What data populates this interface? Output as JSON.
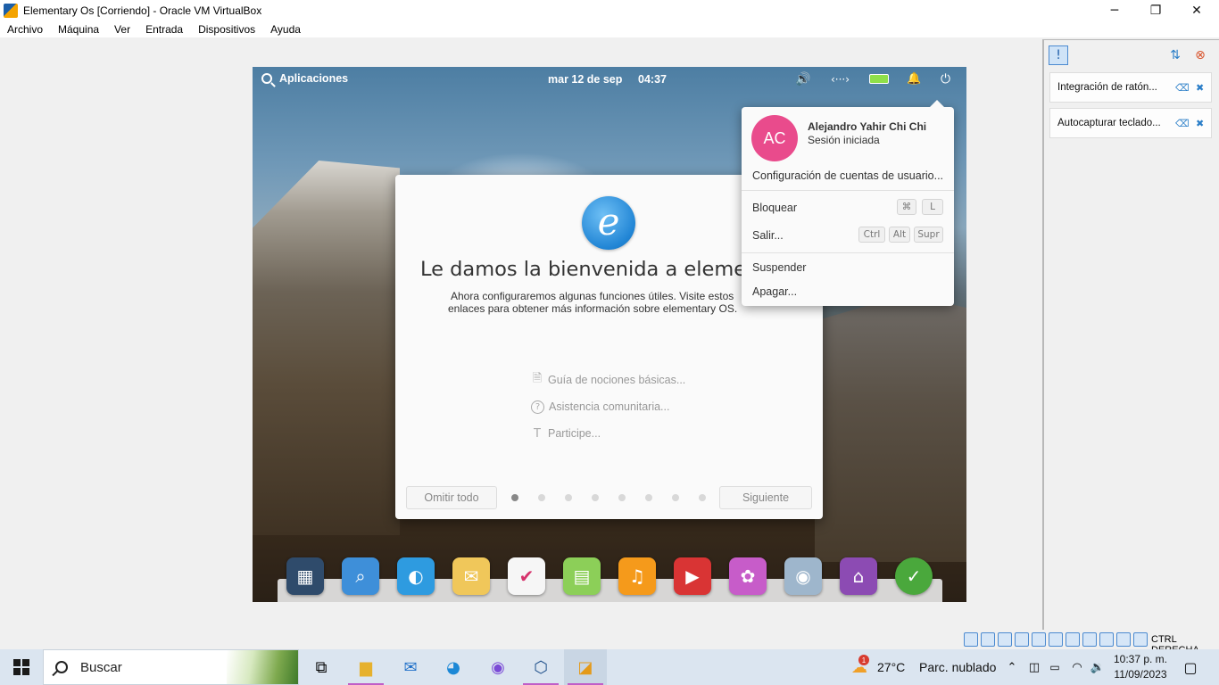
{
  "window": {
    "title": "Elementary Os [Corriendo] - Oracle VM VirtualBox",
    "controls": {
      "minimize": "─",
      "maximize": "❐",
      "close": "✕"
    }
  },
  "menubar": [
    "Archivo",
    "Máquina",
    "Ver",
    "Entrada",
    "Dispositivos",
    "Ayuda"
  ],
  "vm": {
    "panel": {
      "applications": "Aplicaciones",
      "date": "mar 12 de sep",
      "time": "04:37",
      "indicators": {
        "sound": "🔊",
        "network": "‹···›",
        "battery": "▬",
        "notifications": "🔔",
        "power": "⏻"
      }
    },
    "welcome": {
      "heading": "Le damos la bienvenida a elementary",
      "description_line1": "Ahora configuraremos algunas funciones útiles. Visite estos",
      "description_line2": "enlaces para obtener más información sobre elementary OS.",
      "links": [
        {
          "label": "Guía de nociones básicas...",
          "icon": "document-icon",
          "glyph": "🗎"
        },
        {
          "label": "Asistencia comunitaria...",
          "icon": "help-icon",
          "glyph": "?"
        },
        {
          "label": "Participe...",
          "icon": "hammer-icon",
          "glyph": "T"
        }
      ],
      "skip_label": "Omitir todo",
      "next_label": "Siguiente",
      "pages_total": 8,
      "current_page": 1
    },
    "session_menu": {
      "avatar_initials": "AC",
      "avatar_color": "#e94b8c",
      "user_name": "Alejandro Yahir Chi Chi",
      "user_status": "Sesión iniciada",
      "account_settings": "Configuración de cuentas de usuario...",
      "lock": {
        "label": "Bloquear",
        "keys": [
          "⌘",
          "L"
        ]
      },
      "logout": {
        "label": "Salir...",
        "keys": [
          "Ctrl",
          "Alt",
          "Supr"
        ]
      },
      "suspend": "Suspender",
      "shutdown": "Apagar..."
    },
    "dock": [
      {
        "name": "multitasking-view-icon",
        "bg": "#2f4b6b",
        "glyph": "▦"
      },
      {
        "name": "files-icon",
        "bg": "#3e8fd9",
        "glyph": "⌕"
      },
      {
        "name": "web-browser-icon",
        "bg": "#2e9be0",
        "glyph": "◐"
      },
      {
        "name": "mail-icon",
        "bg": "#f0c75a",
        "glyph": "✉"
      },
      {
        "name": "tasks-icon",
        "bg": "#f6f6f6",
        "glyph": "✔"
      },
      {
        "name": "calendar-icon",
        "bg": "#8ccf58",
        "glyph": "▤"
      },
      {
        "name": "music-icon",
        "bg": "#f59a1b",
        "glyph": "♫"
      },
      {
        "name": "videos-icon",
        "bg": "#d93434",
        "glyph": "▶"
      },
      {
        "name": "photos-icon",
        "bg": "#c75cc9",
        "glyph": "✿"
      },
      {
        "name": "system-settings-icon",
        "bg": "#9eb6cc",
        "glyph": "◉"
      },
      {
        "name": "appcenter-icon",
        "bg": "#8c4bb3",
        "glyph": "⌂"
      },
      {
        "name": "installer-icon",
        "bg": "#4aa83c",
        "glyph": "✓"
      }
    ]
  },
  "vbox_panel": {
    "notifications": [
      {
        "label": "Integración de ratón..."
      },
      {
        "label": "Autocapturar teclado..."
      }
    ]
  },
  "statusbar": {
    "host_key": "CTRL DERECHA"
  },
  "taskbar": {
    "search_placeholder": "Buscar",
    "weather_temp": "27°C",
    "weather_desc": "Parc. nublado",
    "weather_badge": "1",
    "time": "10:37 p. m.",
    "date": "11/09/2023"
  }
}
